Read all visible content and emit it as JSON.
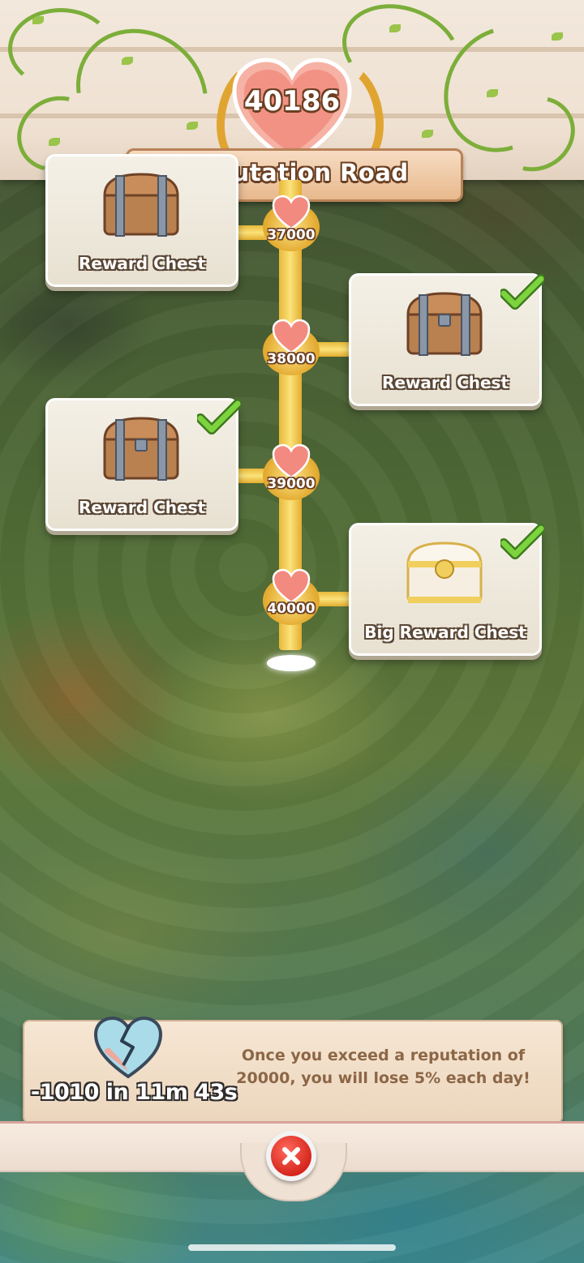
{
  "header": {
    "title": "Reputation Road",
    "score": "40186"
  },
  "milestones": [
    {
      "value": "37000",
      "reward": "Reward Chest",
      "side": "left",
      "claimed": false
    },
    {
      "value": "38000",
      "reward": "Reward Chest",
      "side": "right",
      "claimed": true
    },
    {
      "value": "39000",
      "reward": "Reward Chest",
      "side": "left",
      "claimed": true
    },
    {
      "value": "40000",
      "reward": "Big Reward Chest",
      "side": "right",
      "claimed": true
    }
  ],
  "info": {
    "timer": "-1010 in 11m 43s",
    "message": "Once you exceed a reputation of 20000, you will lose 5% each day!"
  },
  "icons": {
    "heart": "heart-icon",
    "broken_heart": "broken-heart-icon",
    "check": "check-icon",
    "close": "close-icon",
    "chest": "chest-icon",
    "big_chest": "big-chest-icon"
  },
  "colors": {
    "road": "#fbe27a",
    "heart": "#f28a80",
    "check": "#6cc33a",
    "close": "#d6261d"
  }
}
